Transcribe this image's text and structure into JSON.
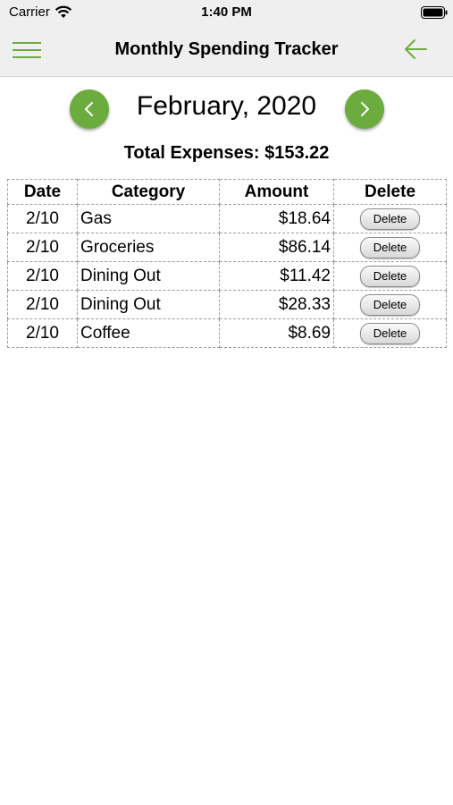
{
  "status_bar": {
    "carrier": "Carrier",
    "time": "1:40 PM",
    "icons": [
      "wifi-icon",
      "battery-icon"
    ]
  },
  "nav": {
    "title": "Monthly Spending Tracker",
    "menu_icon": "hamburger-menu-icon",
    "back_icon": "arrow-left-icon",
    "accent_color": "#6cac3f"
  },
  "month": {
    "label": "February, 2020",
    "prev_icon": "chevron-left-icon",
    "next_icon": "chevron-right-icon"
  },
  "total": {
    "label": "Total Expenses: $153.22"
  },
  "table": {
    "headers": [
      "Date",
      "Category",
      "Amount",
      "Delete"
    ],
    "rows": [
      {
        "date": "2/10",
        "category": "Gas",
        "amount": "$18.64",
        "delete": "Delete"
      },
      {
        "date": "2/10",
        "category": "Groceries",
        "amount": "$86.14",
        "delete": "Delete"
      },
      {
        "date": "2/10",
        "category": "Dining Out",
        "amount": "$11.42",
        "delete": "Delete"
      },
      {
        "date": "2/10",
        "category": "Dining Out",
        "amount": "$28.33",
        "delete": "Delete"
      },
      {
        "date": "2/10",
        "category": "Coffee",
        "amount": "$8.69",
        "delete": "Delete"
      }
    ]
  }
}
